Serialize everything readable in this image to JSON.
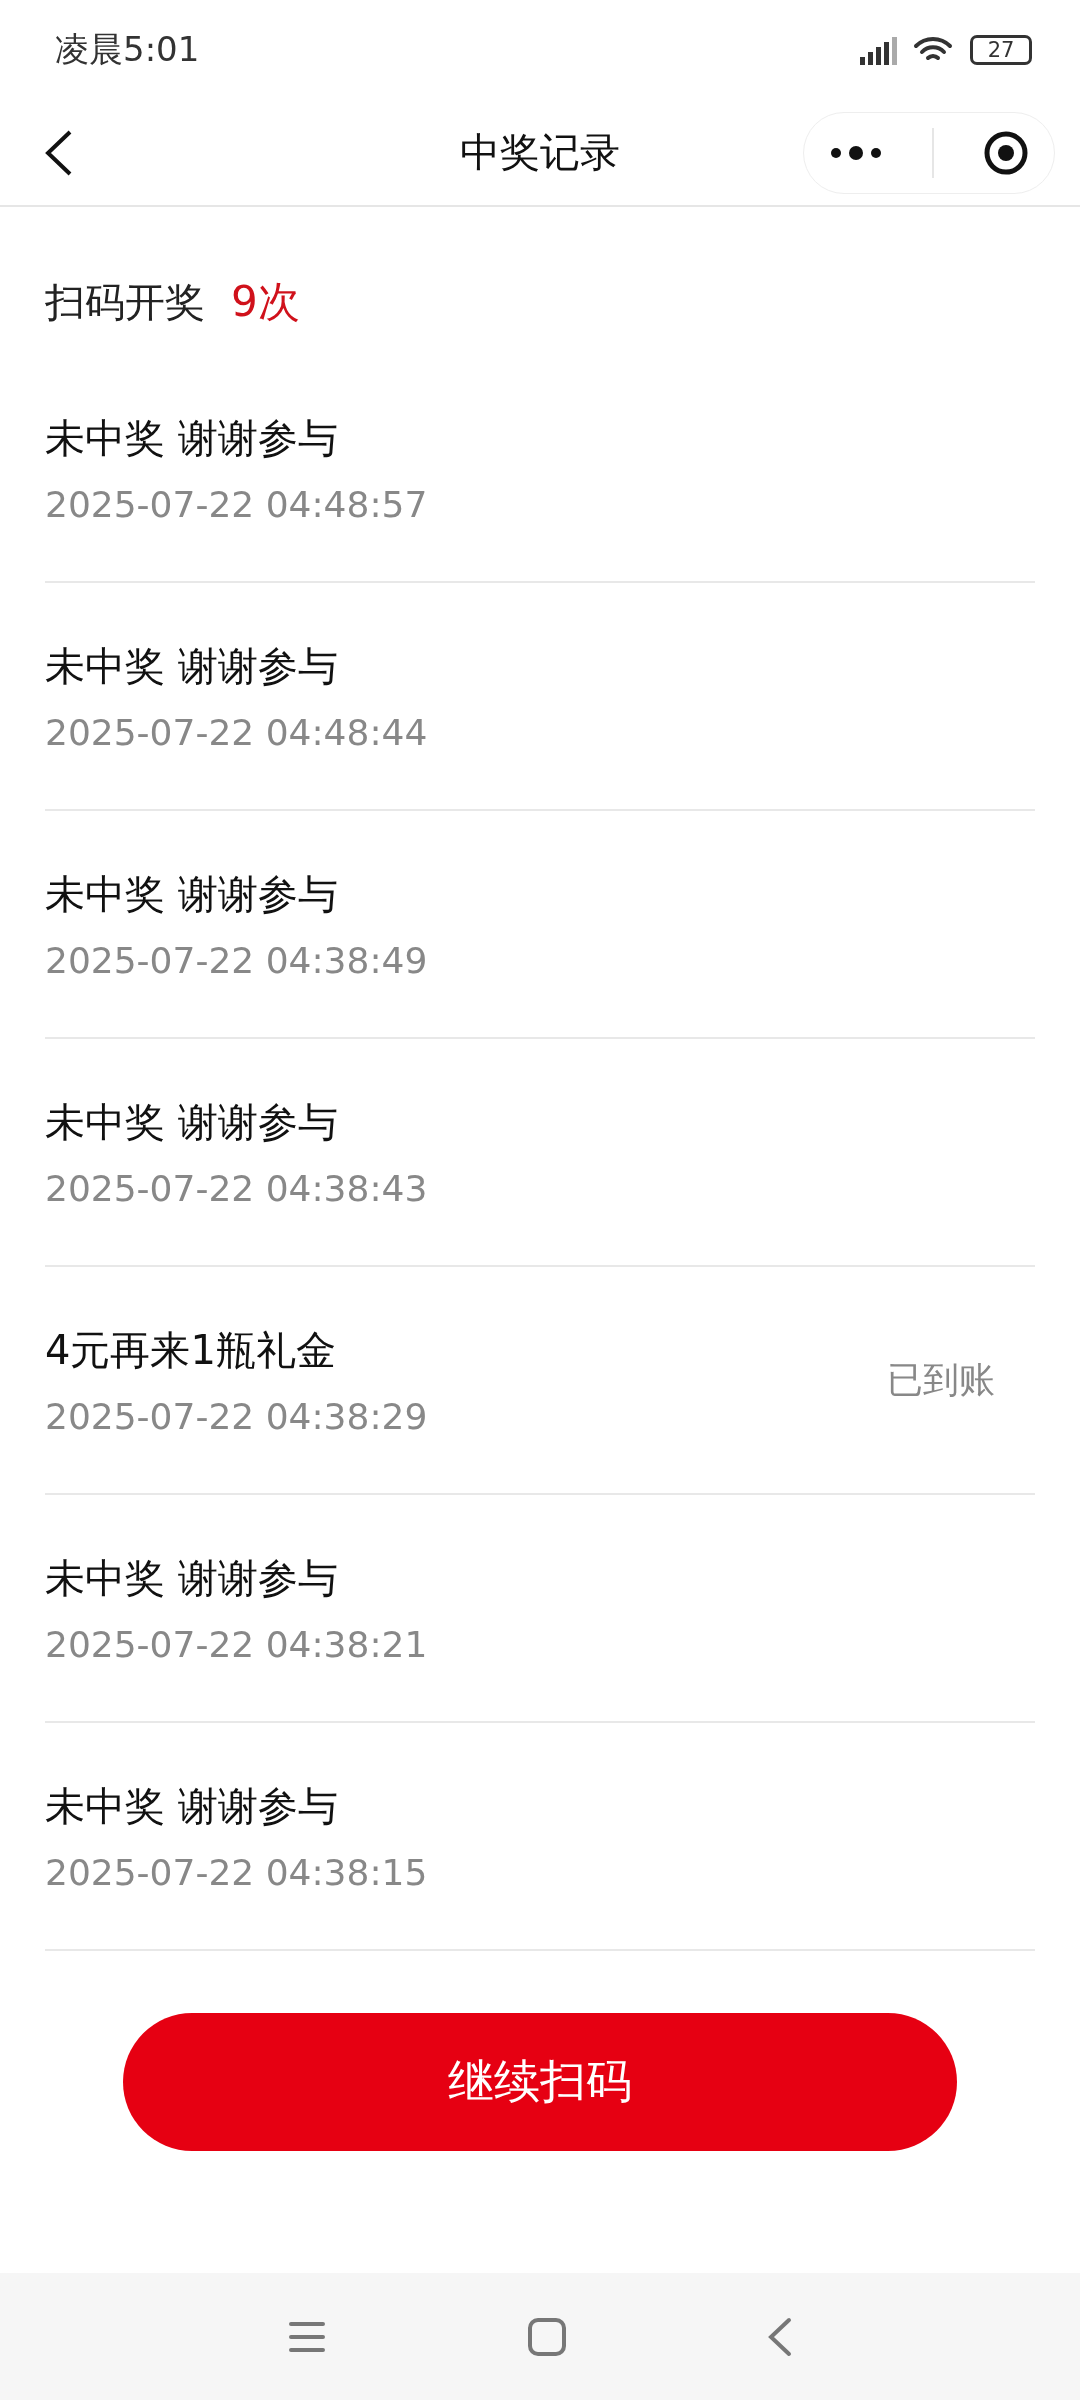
{
  "status_bar": {
    "time": "凌晨5:01",
    "battery": "27"
  },
  "header": {
    "title": "中奖记录"
  },
  "summary": {
    "label": "扫码开奖",
    "count": "9次"
  },
  "records": [
    {
      "title": "未中奖 谢谢参与",
      "time": "2025-07-22 04:48:57"
    },
    {
      "title": "未中奖 谢谢参与",
      "time": "2025-07-22 04:48:44"
    },
    {
      "title": "未中奖 谢谢参与",
      "time": "2025-07-22 04:38:49"
    },
    {
      "title": "未中奖 谢谢参与",
      "time": "2025-07-22 04:38:43"
    },
    {
      "title": "4元再来1瓶礼金",
      "time": "2025-07-22 04:38:29",
      "status": "已到账"
    },
    {
      "title": "未中奖 谢谢参与",
      "time": "2025-07-22 04:38:21"
    },
    {
      "title": "未中奖 谢谢参与",
      "time": "2025-07-22 04:38:15"
    }
  ],
  "button": {
    "label": "继续扫码"
  }
}
